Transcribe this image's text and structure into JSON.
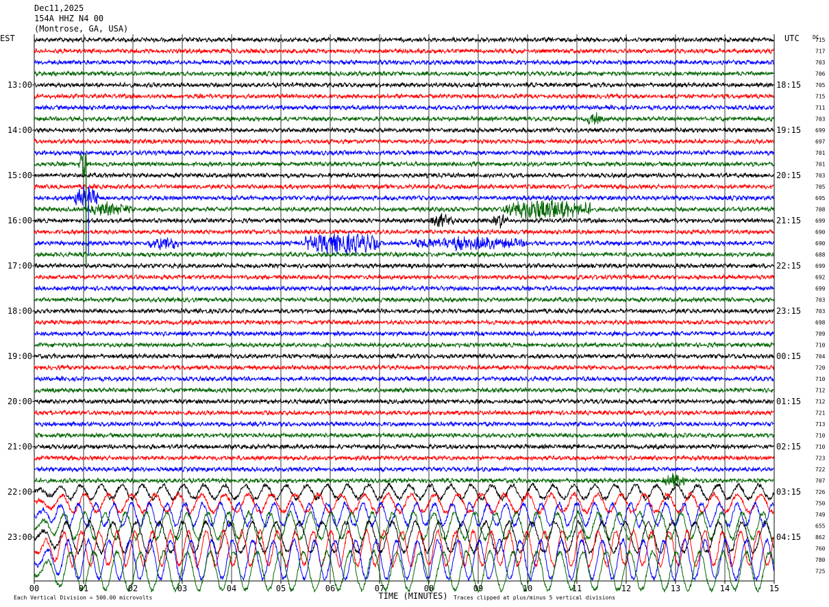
{
  "header": {
    "date": "Dec11,2025",
    "station": "154A HHZ N4 00",
    "location": "(Montrose, GA, USA)"
  },
  "labels": {
    "left_tz": "EST",
    "right_tz": "UTC",
    "dc": "DC",
    "xlabel": "TIME (MINUTES)",
    "footer_left": "Each Vertical Division =  500.00 microvolts",
    "footer_right": "Traces clipped at plus/minus 5 vertical divisions"
  },
  "colors": [
    "#000000",
    "#ff0000",
    "#0000ff",
    "#006400"
  ],
  "chart_data": {
    "type": "line",
    "title": "154A HHZ N4 00",
    "xlabel": "TIME (MINUTES)",
    "ylabel": "",
    "xlim": [
      0,
      15
    ],
    "x_ticks": [
      "00",
      "01",
      "02",
      "03",
      "04",
      "05",
      "06",
      "07",
      "08",
      "09",
      "10",
      "11",
      "12",
      "13",
      "14",
      "15"
    ],
    "y_left_ticks": [
      "13:00",
      "14:00",
      "15:00",
      "16:00",
      "17:00",
      "18:00",
      "19:00",
      "20:00",
      "21:00",
      "22:00",
      "23:00"
    ],
    "y_right_ticks": [
      "18:15",
      "19:15",
      "20:15",
      "21:15",
      "22:15",
      "23:15",
      "00:15",
      "01:15",
      "02:15",
      "03:15",
      "04:15"
    ],
    "tick_trace_indices": [
      4,
      8,
      12,
      16,
      20,
      24,
      28,
      32,
      36,
      40,
      44
    ],
    "trace_count": 48,
    "dc_offsets": [
      715,
      717,
      703,
      706,
      705,
      715,
      711,
      703,
      699,
      697,
      701,
      701,
      703,
      705,
      695,
      708,
      699,
      690,
      690,
      688,
      699,
      692,
      699,
      703,
      703,
      698,
      709,
      710,
      704,
      720,
      710,
      712,
      712,
      721,
      713,
      710,
      710,
      723,
      722,
      707,
      726,
      750,
      749,
      655,
      862,
      760,
      780,
      725
    ],
    "events": [
      {
        "trace": 14,
        "start_min": 0.8,
        "end_min": 1.3,
        "amplitude": "large"
      },
      {
        "trace": 15,
        "start_min": 1.0,
        "end_min": 2.0,
        "amplitude": "medium"
      },
      {
        "trace": 15,
        "start_min": 9.5,
        "end_min": 11.3,
        "amplitude": "large"
      },
      {
        "trace": 16,
        "start_min": 8.0,
        "end_min": 8.5,
        "amplitude": "medium"
      },
      {
        "trace": 16,
        "start_min": 9.3,
        "end_min": 9.6,
        "amplitude": "medium"
      },
      {
        "trace": 18,
        "start_min": 5.5,
        "end_min": 7.0,
        "amplitude": "large"
      },
      {
        "trace": 18,
        "start_min": 2.3,
        "end_min": 3.0,
        "amplitude": "medium"
      },
      {
        "trace": 18,
        "start_min": 7.6,
        "end_min": 10.0,
        "amplitude": "medium"
      },
      {
        "trace": 7,
        "start_min": 11.2,
        "end_min": 11.5,
        "amplitude": "medium"
      },
      {
        "trace": 11,
        "start_min": 0.9,
        "end_min": 1.1,
        "amplitude": "large"
      },
      {
        "trace": 39,
        "start_min": 12.7,
        "end_min": 13.2,
        "amplitude": "medium"
      }
    ],
    "grid": true,
    "legend": "none"
  }
}
